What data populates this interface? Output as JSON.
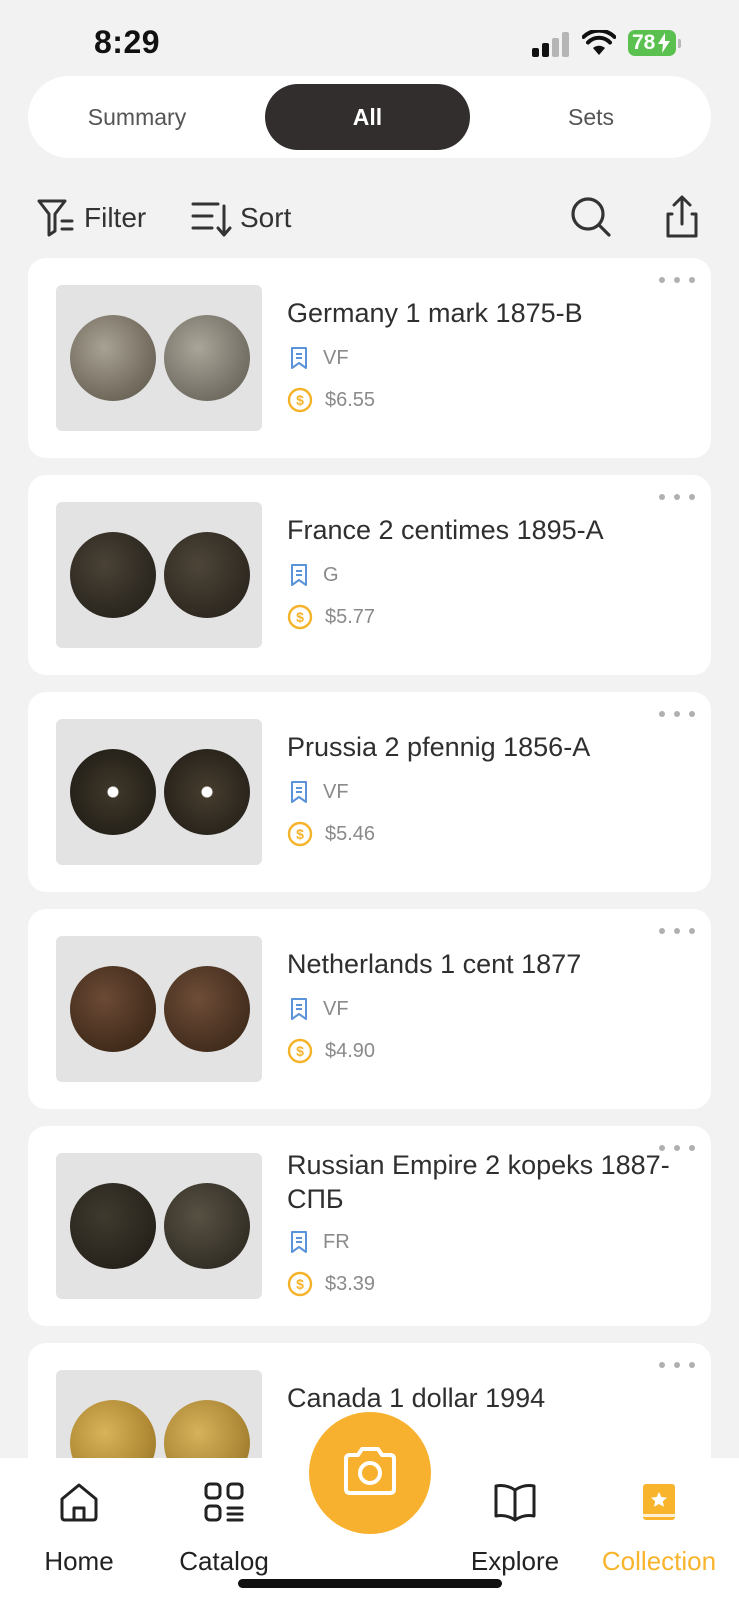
{
  "status_bar": {
    "time": "8:29",
    "battery": "78"
  },
  "tabs": [
    {
      "label": "Summary",
      "active": false
    },
    {
      "label": "All",
      "active": true
    },
    {
      "label": "Sets",
      "active": false
    }
  ],
  "toolbar": {
    "filter_label": "Filter",
    "sort_label": "Sort"
  },
  "coins": [
    {
      "title": "Germany 1 mark 1875-B",
      "grade": "VF",
      "price": "$6.55"
    },
    {
      "title": "France 2 centimes 1895-A",
      "grade": "G",
      "price": "$5.77"
    },
    {
      "title": "Prussia 2 pfennig 1856-A",
      "grade": "VF",
      "price": "$5.46"
    },
    {
      "title": "Netherlands 1 cent 1877",
      "grade": "VF",
      "price": "$4.90"
    },
    {
      "title": "Russian Empire 2 kopeks 1887-СПБ",
      "grade": "FR",
      "price": "$3.39"
    },
    {
      "title": "Canada 1 dollar 1994",
      "grade": "",
      "price": ""
    }
  ],
  "nav": {
    "home": "Home",
    "catalog": "Catalog",
    "explore": "Explore",
    "collection": "Collection"
  },
  "colors": {
    "accent": "#f8b12f",
    "active_tab_bg": "#322e2e",
    "grade_icon": "#5b93d8",
    "price_icon": "#f5b32a",
    "battery": "#5ac04f"
  }
}
